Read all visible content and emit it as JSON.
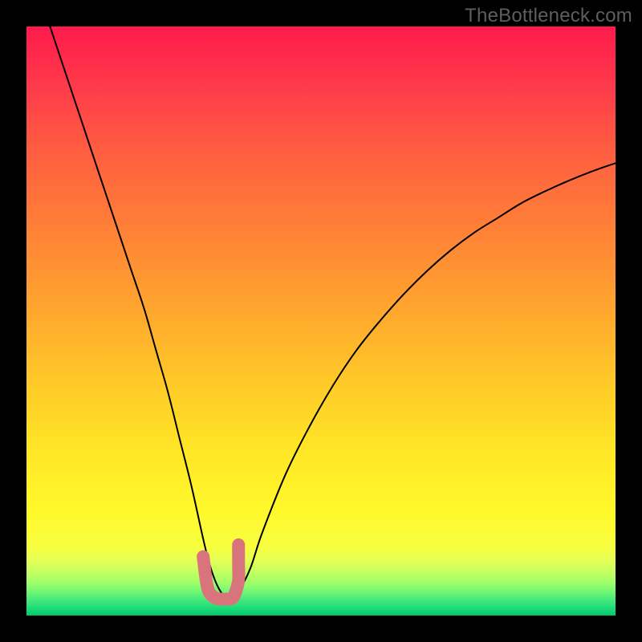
{
  "watermark": "TheBottleneck.com",
  "chart_data": {
    "type": "line",
    "title": "",
    "xlabel": "",
    "ylabel": "",
    "xlim": [
      0,
      100
    ],
    "ylim": [
      0,
      100
    ],
    "grid": false,
    "legend": false,
    "background_gradient": {
      "top_color": "#ff1a4c",
      "mid_color": "#ffd633",
      "bottom_colors": [
        "#ffff66",
        "#e6ff66",
        "#99ff66",
        "#33e080",
        "#00c864"
      ]
    },
    "series": [
      {
        "name": "bottleneck-curve",
        "stroke": "#000000",
        "stroke_width": 2,
        "x": [
          4,
          6,
          8,
          10,
          12,
          14,
          16,
          18,
          20,
          22,
          24,
          26,
          28,
          30,
          31,
          32,
          33,
          34,
          35,
          36,
          38,
          40,
          44,
          48,
          52,
          56,
          60,
          64,
          68,
          72,
          76,
          80,
          84,
          88,
          92,
          96,
          100
        ],
        "values": [
          100,
          94,
          88,
          82,
          76,
          70,
          64,
          58,
          52,
          45,
          38,
          30,
          22,
          13,
          9,
          6,
          4,
          3,
          3,
          4,
          8,
          14,
          24,
          32,
          39,
          45,
          50,
          54.5,
          58.5,
          62,
          65,
          67.5,
          70,
          72,
          73.8,
          75.4,
          76.8
        ]
      },
      {
        "name": "optimal-marker",
        "stroke": "#d9747c",
        "stroke_width": 16,
        "stroke_linecap": "round",
        "x": [
          30,
          30.5,
          31,
          32,
          33,
          34,
          35,
          35.5,
          36,
          36,
          36
        ],
        "values": [
          10,
          6,
          4,
          3,
          2.8,
          2.8,
          3,
          4,
          6,
          9,
          12
        ]
      }
    ]
  }
}
